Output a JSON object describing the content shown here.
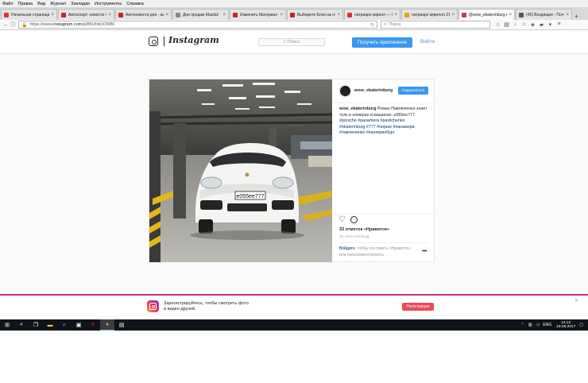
{
  "menu": [
    "Файл",
    "Правка",
    "Вид",
    "Журнал",
    "Закладки",
    "Инструменты",
    "Справка"
  ],
  "tabs": [
    {
      "label": "Начальная страница M",
      "color": "#d33"
    },
    {
      "label": "Автоспорт: новости Ф",
      "color": "#c22"
    },
    {
      "label": "Автоновости дня - авто",
      "color": "#c22"
    },
    {
      "label": "Дни продаж Mazda!",
      "color": "#888"
    },
    {
      "label": "Изменить Материал |",
      "color": "#c22"
    },
    {
      "label": "Выберите Блок на гла",
      "color": "#c22"
    },
    {
      "label": "патриарх кирилл — Я",
      "color": "#d33"
    },
    {
      "label": "патриарх кириллл 21",
      "color": "#e6a100"
    },
    {
      "label": "@wow_ekaterinburg в",
      "color": "#c13584",
      "active": true
    },
    {
      "label": "(45) Входящие - Почт",
      "color": "#555"
    }
  ],
  "nav": {
    "url_prefix": "https://www.",
    "url_domain": "instagram.com",
    "url_path": "/p/BNJhbOOMB/",
    "search_placeholder": "Поиск"
  },
  "ig": {
    "wordmark": "Instagram",
    "search_placeholder": "Поиск",
    "get_app": "Получить приложение",
    "login": "Войти"
  },
  "post": {
    "username": "wow_ekaterinburg",
    "follow": "Подписаться",
    "caption_user": "wow_ekaterinburg",
    "caption_text": " Роман Павлюченко знает толк в номерах и машинах. е055ее777.",
    "hashtags": "#porsche #panamera #pavlichenko #ekaterinburg #777 #порше #панамера #павлюченко #екатеринбург",
    "likes": "33 отметок «Нравится»",
    "time": "22 ЧАСА НАЗАД",
    "login_link": "Войдите",
    "login_rest": ", чтобы поставить «Нравится» или прокомментировать.",
    "plate": "е055ее777"
  },
  "banner": {
    "text": "Зарегистрируйтесь, чтобы смотреть фото и видео друзей.",
    "register": "Регистрация"
  },
  "taskbar": {
    "lang": "ENG",
    "time": "14:12",
    "date": "19.06.2017"
  }
}
